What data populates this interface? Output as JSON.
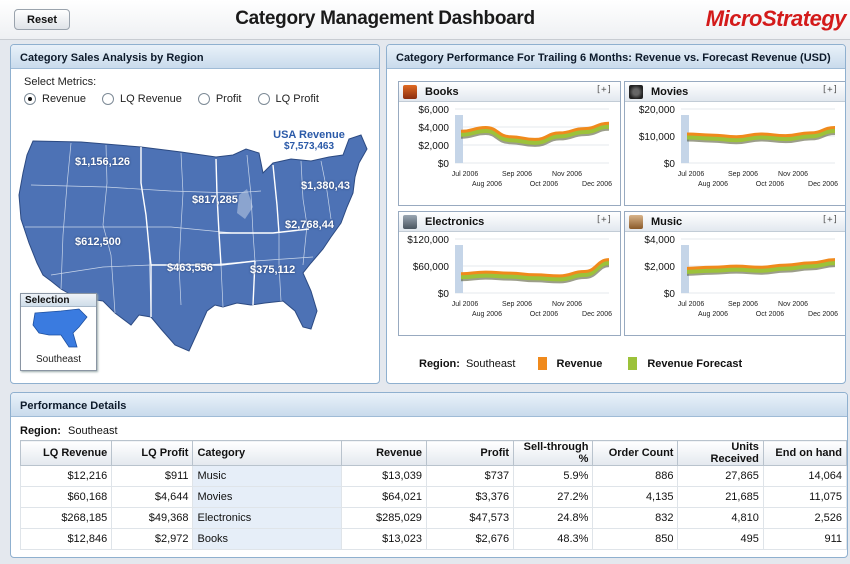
{
  "header": {
    "reset_label": "Reset",
    "title": "Category Management Dashboard",
    "logo_text": "MicroStrategy"
  },
  "map_panel": {
    "title": "Category Sales Analysis by Region",
    "select_metrics_label": "Select Metrics:",
    "metrics": [
      {
        "label": "Revenue",
        "selected": true
      },
      {
        "label": "LQ Revenue",
        "selected": false
      },
      {
        "label": "Profit",
        "selected": false
      },
      {
        "label": "LQ Profit",
        "selected": false
      }
    ],
    "usa_revenue_label": "USA Revenue",
    "usa_revenue_value": "$7,573,463",
    "region_values": [
      "$1,156,126",
      "$817,285",
      "$1,380,43",
      "$2,768,44",
      "$612,500",
      "$463,556",
      "$375,112"
    ],
    "selection_title": "Selection",
    "selection_name": "Southeast"
  },
  "trend_panel": {
    "title": "Category Performance For Trailing 6 Months: Revenue vs. Forecast Revenue (USD)",
    "expand_label": "[+]",
    "x_top_ticks": [
      "Jul 2006",
      "Sep 2006",
      "Nov 2006"
    ],
    "x_bottom_ticks": [
      "Aug 2006",
      "Oct 2006",
      "Dec 2006"
    ],
    "tiles": [
      {
        "title": "Books",
        "icon": "books-icon",
        "y_ticks": [
          "$6,000",
          "$4,000",
          "$2,000",
          "$0"
        ]
      },
      {
        "title": "Movies",
        "icon": "movies-icon",
        "y_ticks": [
          "$20,000",
          "$10,000",
          "$0"
        ]
      },
      {
        "title": "Electronics",
        "icon": "electronics-icon",
        "y_ticks": [
          "$120,000",
          "$60,000",
          "$0"
        ]
      },
      {
        "title": "Music",
        "icon": "music-icon",
        "y_ticks": [
          "$4,000",
          "$2,000",
          "$0"
        ]
      }
    ],
    "legend_region_label": "Region:",
    "legend_region_value": "Southeast",
    "legend_series": [
      "Revenue",
      "Revenue Forecast"
    ],
    "colors": {
      "revenue": "#f08a1c",
      "forecast": "#9cc23a",
      "band": "#c5d5e8"
    }
  },
  "details_panel": {
    "title": "Performance Details",
    "region_label": "Region:",
    "region_value": "Southeast",
    "columns": [
      "LQ Revenue",
      "LQ Profit",
      "Category",
      "Revenue",
      "Profit",
      "Sell-through %",
      "Order Count",
      "Units Received",
      "End on hand"
    ],
    "rows": [
      [
        "$12,216",
        "$911",
        "Music",
        "$13,039",
        "$737",
        "5.9%",
        "886",
        "27,865",
        "14,064"
      ],
      [
        "$60,168",
        "$4,644",
        "Movies",
        "$64,021",
        "$3,376",
        "27.2%",
        "4,135",
        "21,685",
        "11,075"
      ],
      [
        "$268,185",
        "$49,368",
        "Electronics",
        "$285,029",
        "$47,573",
        "24.8%",
        "832",
        "4,810",
        "2,526"
      ],
      [
        "$12,846",
        "$2,972",
        "Books",
        "$13,023",
        "$2,676",
        "48.3%",
        "850",
        "495",
        "911"
      ]
    ]
  }
}
